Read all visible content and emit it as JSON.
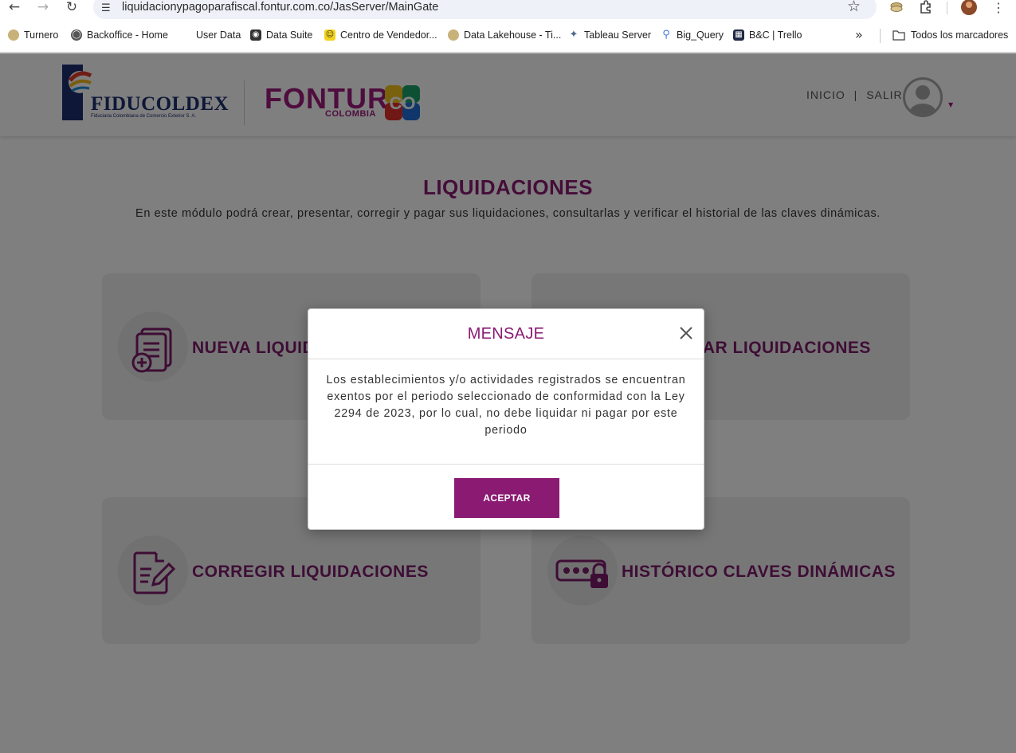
{
  "browser": {
    "url": "liquidacionypagoparafiscal.fontur.com.co/JasServer/MainGate",
    "bookmarks": [
      {
        "label": "Turnero",
        "icon": "coins-icon",
        "color": "#c9b27a"
      },
      {
        "label": "Backoffice - Home",
        "icon": "globe-icon",
        "color": "#555555"
      },
      {
        "label": "User Data",
        "icon": "none",
        "color": "#ffffff"
      },
      {
        "label": "Data Suite",
        "icon": "data-suite-icon",
        "color": "#333333"
      },
      {
        "label": "Centro de Vendedor...",
        "icon": "vendor-icon",
        "color": "#f2d21a"
      },
      {
        "label": "Data Lakehouse - Ti...",
        "icon": "coins-icon",
        "color": "#c9b27a"
      },
      {
        "label": "Tableau Server",
        "icon": "tableau-icon",
        "color": "#4a6b8a"
      },
      {
        "label": "Big_Query",
        "icon": "bigquery-icon",
        "color": "#4a7bd6"
      },
      {
        "label": "B&C | Trello",
        "icon": "trello-icon",
        "color": "#1f2a44"
      }
    ],
    "more_bookmarks": "»",
    "all_bookmarks": "Todos los marcadores"
  },
  "header": {
    "fidu_logo_text": "FIDUCOLDEX",
    "fidu_logo_sub": "Fiduciaria Colombiana de Comercio Exterior S. A.",
    "fontur_logo_text": "FONTUR",
    "fontur_logo_sub": "COLOMBIA",
    "fontur_badge": "CO",
    "nav": {
      "home": "INICIO",
      "separator": "|",
      "logout": "SALIR"
    }
  },
  "main": {
    "title": "LIQUIDACIONES",
    "description": "En este módulo podrá crear, presentar, corregir y pagar sus liquidaciones, consultarlas y verificar el historial de las claves dinámicas.",
    "cards": [
      {
        "label": "NUEVA LIQUIDACIÓN",
        "icon": "new-document-icon"
      },
      {
        "label": "CONSULTAR LIQUIDACIONES",
        "icon": "search-document-icon"
      },
      {
        "label": "CORREGIR LIQUIDACIONES",
        "icon": "edit-document-icon"
      },
      {
        "label": "HISTÓRICO CLAVES DINÁMICAS",
        "icon": "password-lock-icon"
      }
    ]
  },
  "modal": {
    "title": "MENSAJE",
    "message": "Los establecimientos y/o actividades registrados se encuentran exentos por el periodo seleccionado de conformidad con la Ley 2294 de 2023, por lo cual, no debe liquidar ni pagar por este periodo",
    "accept_label": "ACEPTAR"
  },
  "colors": {
    "brand": "#8a1a72",
    "overlay": "rgba(0,0,0,0.5)"
  }
}
